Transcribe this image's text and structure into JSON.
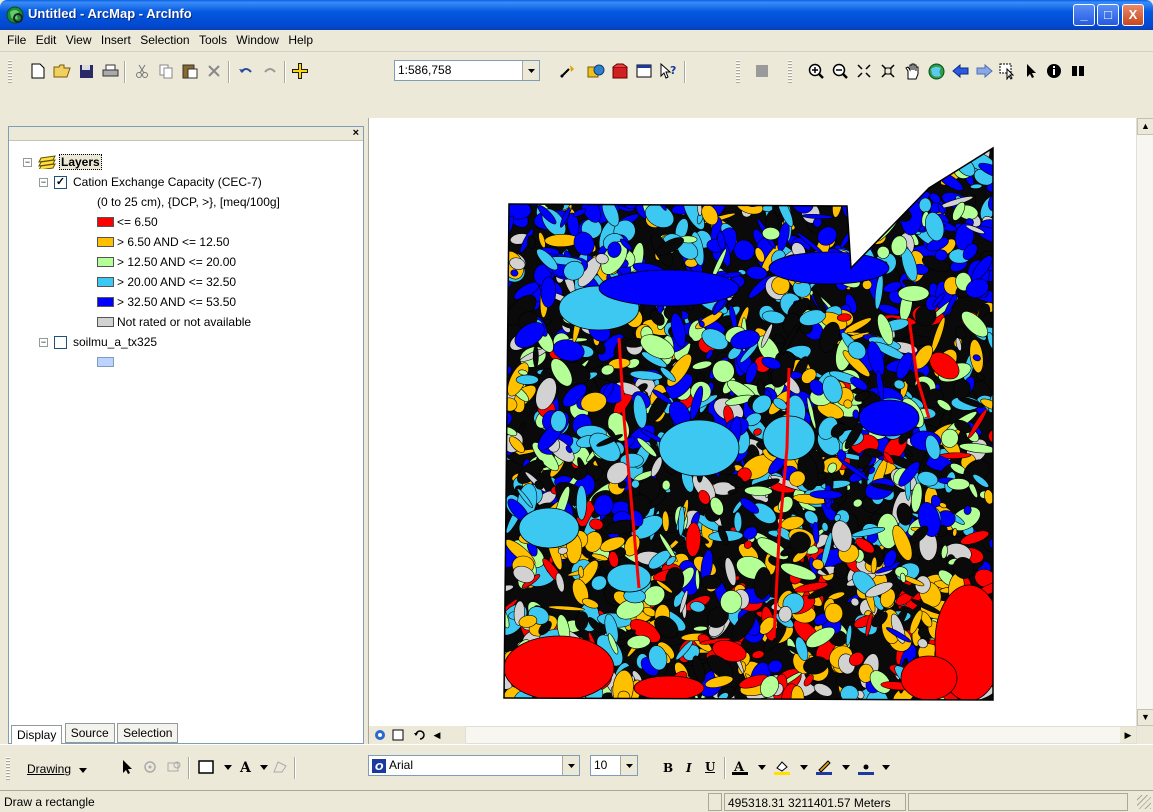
{
  "window": {
    "title": "Untitled - ArcMap - ArcInfo",
    "minimize": "_",
    "maximize": "□",
    "close": "X"
  },
  "menu": [
    "File",
    "Edit",
    "View",
    "Insert",
    "Selection",
    "Tools",
    "Window",
    "Help"
  ],
  "toolbar": {
    "scale": "1:586,758"
  },
  "toc": {
    "root_label": "Layers",
    "layers": [
      {
        "name": "Cation Exchange Capacity (CEC-7)",
        "subtitle": "(0 to 25 cm), {DCP, >}, [meq/100g]",
        "checked": true,
        "legend": [
          {
            "label": "<= 6.50",
            "color": "#ff0000"
          },
          {
            "label": "> 6.50 AND <= 12.50",
            "color": "#ffc000"
          },
          {
            "label": "> 12.50 AND <= 20.00",
            "color": "#b4ff96"
          },
          {
            "label": "> 20.00 AND <= 32.50",
            "color": "#3cc8f0"
          },
          {
            "label": "> 32.50 AND <= 53.50",
            "color": "#0000ff"
          },
          {
            "label": "Not rated or not available",
            "color": "#d2d2d2"
          }
        ]
      },
      {
        "name": "soilmu_a_tx325",
        "checked": false,
        "legend": [
          {
            "label": "",
            "color": "#bed2ff"
          }
        ]
      }
    ],
    "tabs": [
      "Display",
      "Source",
      "Selection"
    ]
  },
  "drawing": {
    "label": "Drawing",
    "font": "Arial",
    "font_size": "10"
  },
  "status": {
    "message": "Draw a rectangle",
    "coordinates": "495318.31  3211401.57 Meters"
  }
}
